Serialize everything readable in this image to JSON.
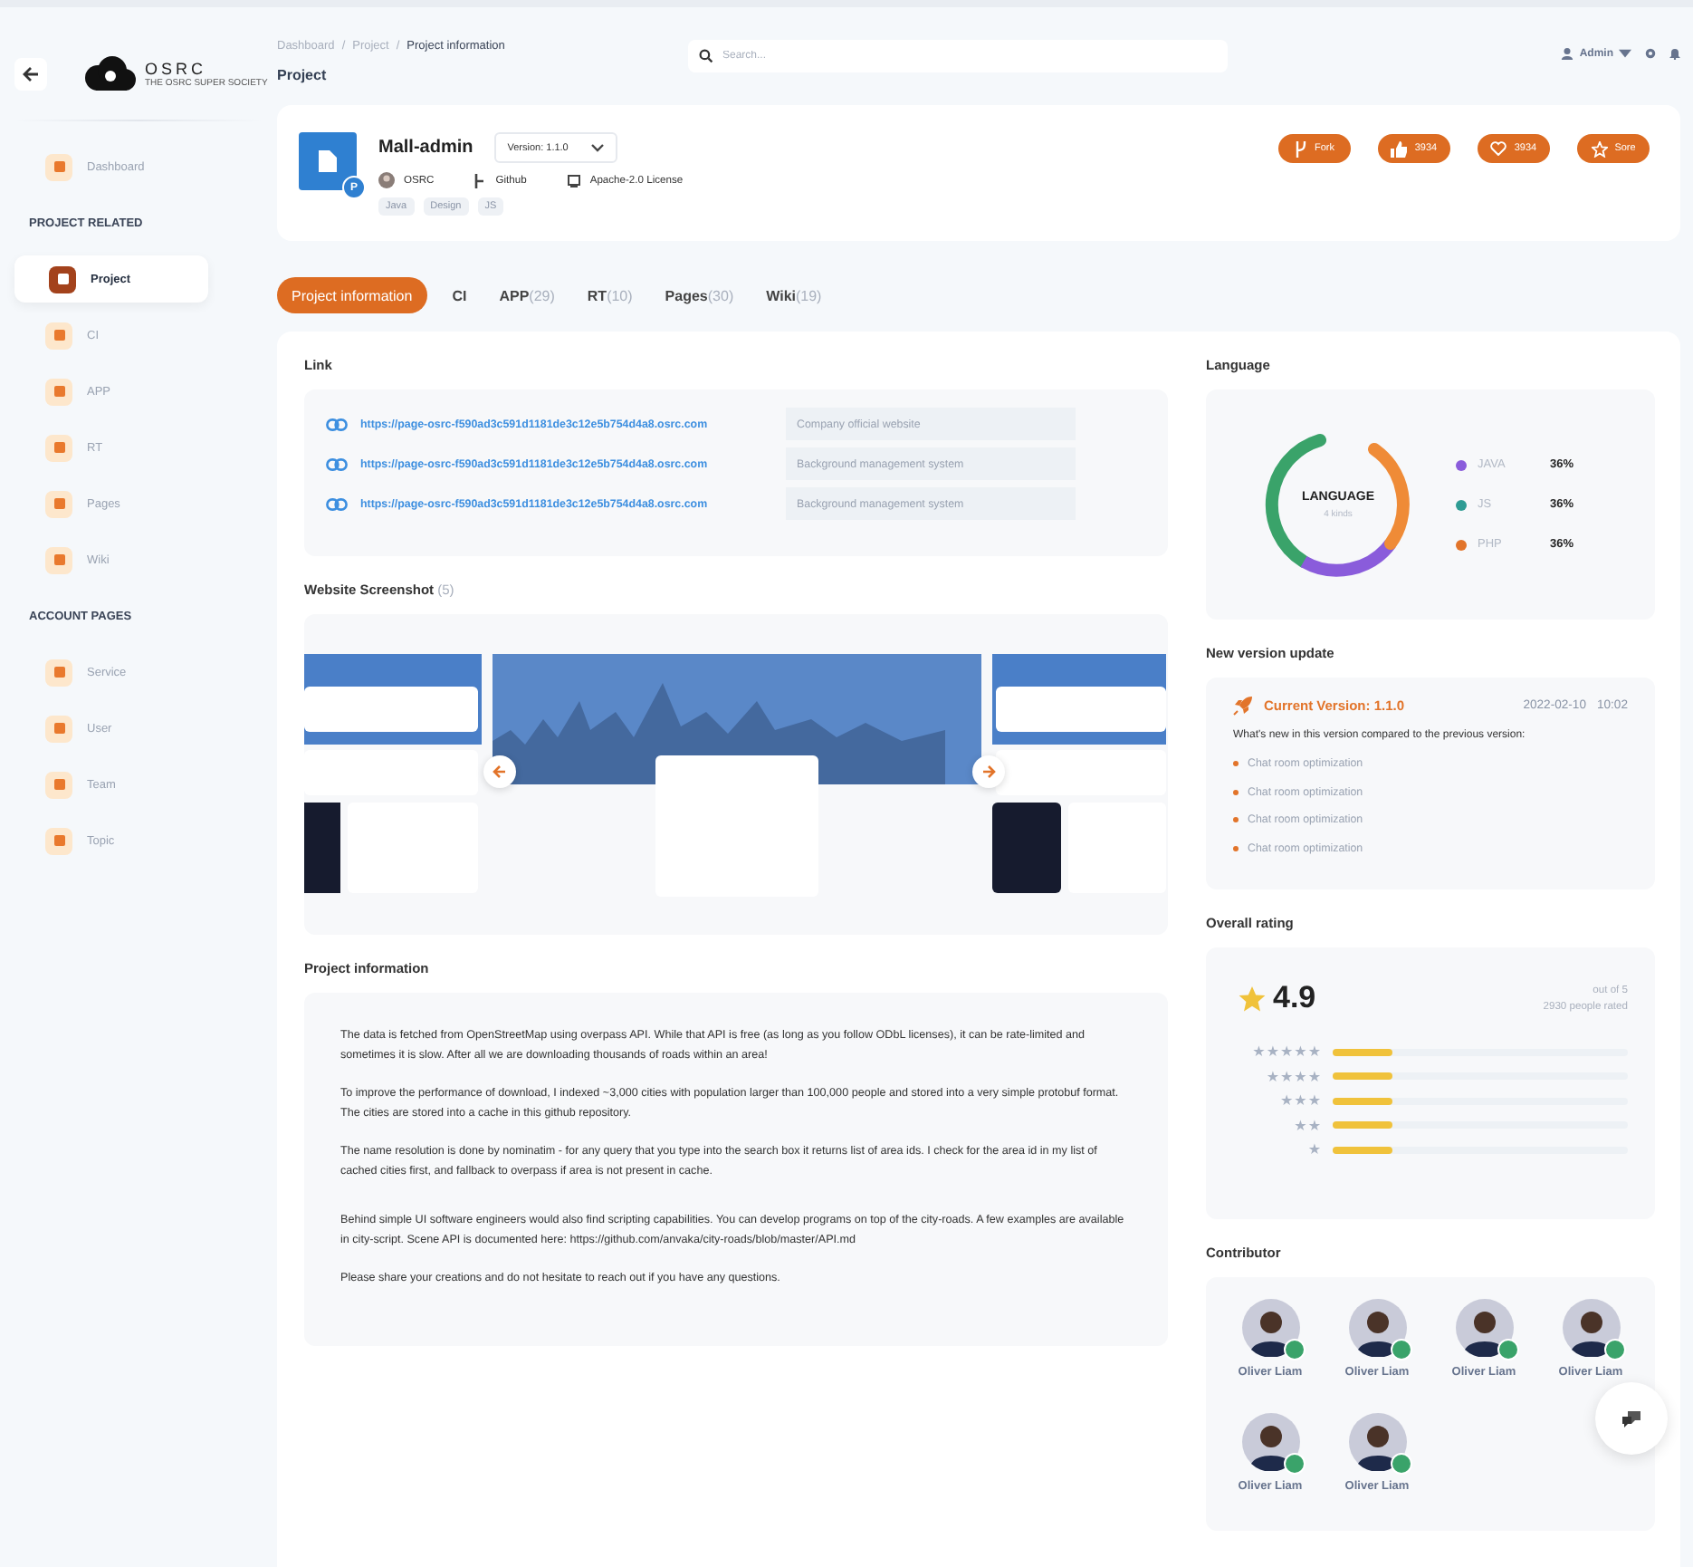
{
  "sidebar": {
    "logo": "OSRC",
    "logo_tagline": "THE OSRC SUPER SOCIETY",
    "items": [
      {
        "label": "Dashboard",
        "selected": false,
        "kind": "item"
      },
      {
        "label": "PROJECT RELATED",
        "kind": "section"
      },
      {
        "label": "Project",
        "selected": true,
        "kind": "item"
      },
      {
        "label": "CI",
        "selected": false,
        "kind": "item"
      },
      {
        "label": "APP",
        "selected": false,
        "kind": "item"
      },
      {
        "label": "RT",
        "selected": false,
        "kind": "item"
      },
      {
        "label": "Pages",
        "selected": false,
        "kind": "item"
      },
      {
        "label": "Wiki",
        "selected": false,
        "kind": "item"
      },
      {
        "label": "ACCOUNT PAGES",
        "kind": "section"
      },
      {
        "label": "Service",
        "selected": false,
        "kind": "item"
      },
      {
        "label": "User",
        "selected": false,
        "kind": "item"
      },
      {
        "label": "Team",
        "selected": false,
        "kind": "item"
      },
      {
        "label": "Topic",
        "selected": false,
        "kind": "item"
      }
    ]
  },
  "breadcrumbs": [
    "Dashboard",
    "Project",
    "Project information"
  ],
  "breadcrumb_separator": "/",
  "page_title": "Project",
  "search": {
    "placeholder": "Search..."
  },
  "user": {
    "name": "Admin"
  },
  "project": {
    "name": "Mall-admin",
    "badge": "P",
    "version": "Version: 1.1.0",
    "owner": "OSRC",
    "source": "Github",
    "license": "Apache-2.0 License",
    "tags": [
      "Java",
      "Design",
      "JS"
    ],
    "actions": [
      {
        "label": "Fork",
        "kind": "fork"
      },
      {
        "label": "3934",
        "kind": "like"
      },
      {
        "label": "3934",
        "kind": "heart"
      },
      {
        "label": "Sore",
        "kind": "star"
      }
    ]
  },
  "tabs": [
    {
      "label": "Project information",
      "selected": true
    },
    {
      "label": "CI",
      "selected": false
    },
    {
      "label": "APP",
      "count": "(29)",
      "selected": false
    },
    {
      "label": "RT",
      "count": "(10)",
      "selected": false
    },
    {
      "label": "Pages",
      "count": "(30)",
      "selected": false
    },
    {
      "label": "Wiki",
      "count": "(19)",
      "selected": false
    }
  ],
  "links": {
    "title": "Link",
    "rows": [
      {
        "url": "https://page-osrc-f590ad3c591d1181de3c12e5b754d4a8.osrc.com",
        "description": "Company official website"
      },
      {
        "url": "https://page-osrc-f590ad3c591d1181de3c12e5b754d4a8.osrc.com",
        "description": "Background management system"
      },
      {
        "url": "https://page-osrc-f590ad3c591d1181de3c12e5b754d4a8.osrc.com",
        "description": "Background management system"
      }
    ]
  },
  "screenshots": {
    "title": "Website Screenshot",
    "count": "(5)",
    "kind": "picture"
  },
  "info": {
    "title": "Project information",
    "paragraphs": [
      "The data is fetched from OpenStreetMap using overpass API. While that API is free (as long as you follow ODbL licenses), it can be rate-limited and sometimes it is slow. After all we are downloading thousands of roads within an area!",
      "To improve the performance of download, I indexed ~3,000 cities with population larger than 100,000 people and stored into a very simple protobuf format. The cities are stored into a cache in this github repository.",
      "The name resolution is done by nominatim - for any query that you type into the search box it returns list of area ids. I check for the area id in my list of cached cities first, and fallback to overpass if area is not present in cache.",
      "Behind simple UI software engineers would also find scripting capabilities. You can develop programs on top of the city-roads. A few examples are available in city-script. Scene API is documented here: https://github.com/anvaka/city-roads/blob/master/API.md",
      "Please share your creations and do not hesitate to reach out if you have any questions."
    ]
  },
  "language": {
    "title": "Language",
    "center_title": "LANGUAGE",
    "center_subtitle": "4 kinds",
    "items": [
      {
        "name": "JAVA",
        "color": "#8a5cdb",
        "share": "36%"
      },
      {
        "name": "JS",
        "color": "#2e9c94",
        "share": "36%"
      },
      {
        "name": "PHP",
        "color": "#e2742a",
        "share": "36%"
      }
    ]
  },
  "update": {
    "title": "New version update",
    "version": "Current Version: 1.1.0",
    "date": "2022-02-10",
    "time": "10:02",
    "intro": "What's new in this version compared to the previous version:",
    "changes": [
      "Chat room optimization",
      "Chat room optimization",
      "Chat room optimization",
      "Chat room optimization"
    ]
  },
  "rating": {
    "title": "Overall rating",
    "score": "4.9",
    "out_of": "out of 5",
    "count": "2930 people rated",
    "rows": [
      {
        "label": "★★★★★",
        "level": 0.2
      },
      {
        "label": "★★★★",
        "level": 0.2
      },
      {
        "label": "★★★",
        "level": 0.2
      },
      {
        "label": "★★",
        "level": 0.2
      },
      {
        "label": "★",
        "level": 0.2
      }
    ]
  },
  "contributors": {
    "title": "Contributor",
    "people": [
      {
        "name": "Oliver Liam",
        "online": true
      },
      {
        "name": "Oliver Liam",
        "online": true
      },
      {
        "name": "Oliver Liam",
        "online": true
      },
      {
        "name": "Oliver Liam",
        "online": true
      },
      {
        "name": "Oliver Liam",
        "online": true
      },
      {
        "name": "Oliver Liam",
        "online": true
      }
    ]
  }
}
